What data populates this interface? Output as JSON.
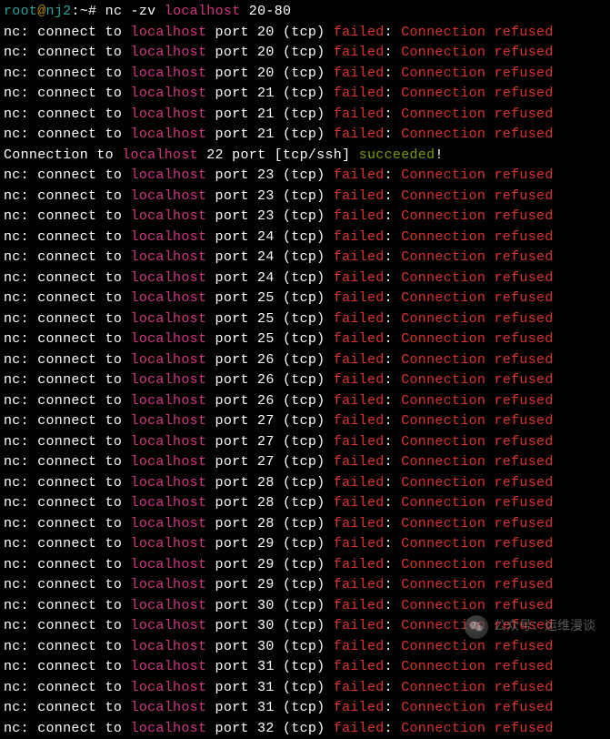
{
  "prompt": {
    "user": "root",
    "host": "nj2",
    "path": "~",
    "symbol": "#",
    "command": "nc -zv",
    "target": "localhost",
    "portrange": "20-80"
  },
  "fail": {
    "prefix": "nc:",
    "connect": "connect to",
    "host": "localhost",
    "port_word": "port",
    "proto": "(tcp)",
    "failed": "failed",
    "colon": ":",
    "reason": "Connection refused"
  },
  "success": {
    "prefix": "Connection to",
    "host": "localhost",
    "mid": "22 port [tcp/ssh]",
    "succeeded": "succeeded",
    "bang": "!"
  },
  "ports": [
    20,
    20,
    20,
    21,
    21,
    21,
    23,
    23,
    23,
    24,
    24,
    24,
    25,
    25,
    25,
    26,
    26,
    26,
    27,
    27,
    27,
    28,
    28,
    28,
    29,
    29,
    29,
    30,
    30,
    30,
    31,
    31,
    31,
    32
  ],
  "success_after_index": 5,
  "watermark": {
    "label": "公众号：运维漫谈"
  }
}
